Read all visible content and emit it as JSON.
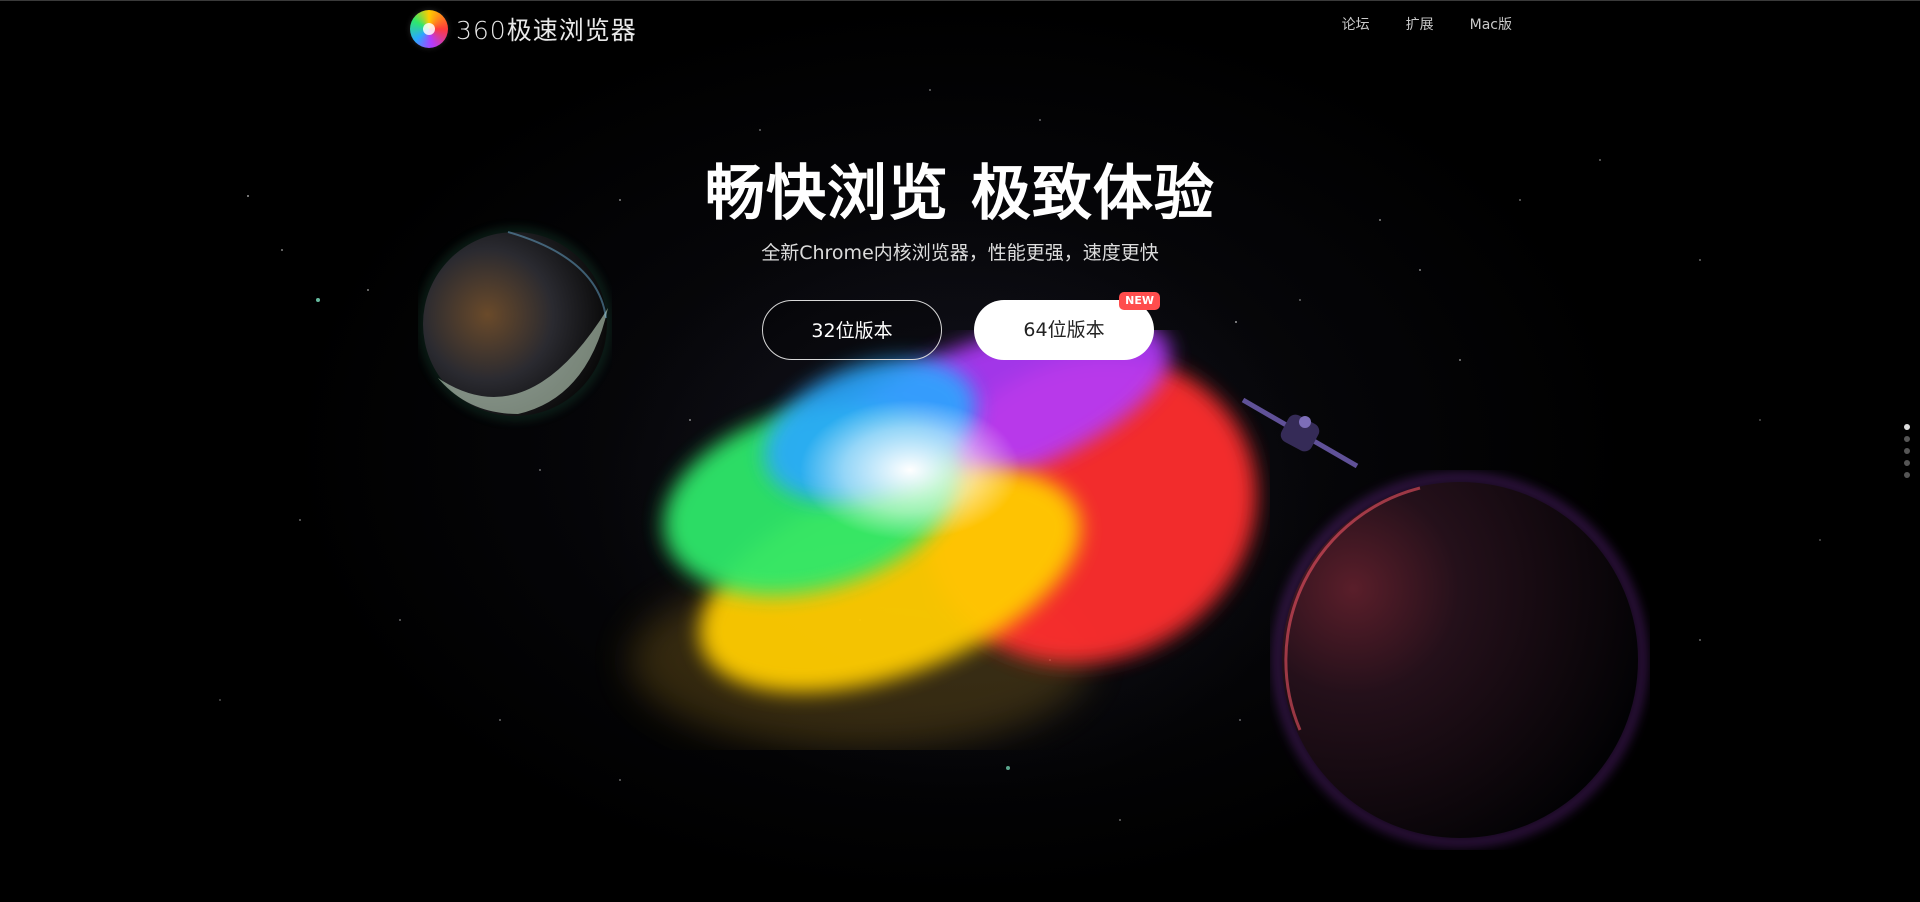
{
  "header": {
    "logo_text": "360极速浏览器",
    "nav": [
      {
        "label": "论坛"
      },
      {
        "label": "扩展"
      },
      {
        "label": "Mac版"
      }
    ]
  },
  "hero": {
    "title": "畅快浏览 极致体验",
    "subtitle": "全新Chrome内核浏览器，性能更强，速度更快",
    "buttons": {
      "btn32_label": "32位版本",
      "btn64_label": "64位版本",
      "btn64_badge": "NEW"
    }
  },
  "pager": {
    "count": 5,
    "active_index": 0
  },
  "colors": {
    "background": "#000000",
    "badge": "#ff4d4d",
    "button_primary_bg": "#ffffff",
    "swirl_green": "#2ee86b",
    "swirl_blue": "#2aa8ff",
    "swirl_purple": "#b23bff",
    "swirl_red": "#ff3b3b",
    "swirl_yellow": "#ffcc00"
  },
  "icons": {
    "logo": "360-browser-logo-icon",
    "planet_left": "ringed-planet-illustration",
    "planet_right": "red-planet-illustration",
    "satellite": "satellite-illustration"
  }
}
